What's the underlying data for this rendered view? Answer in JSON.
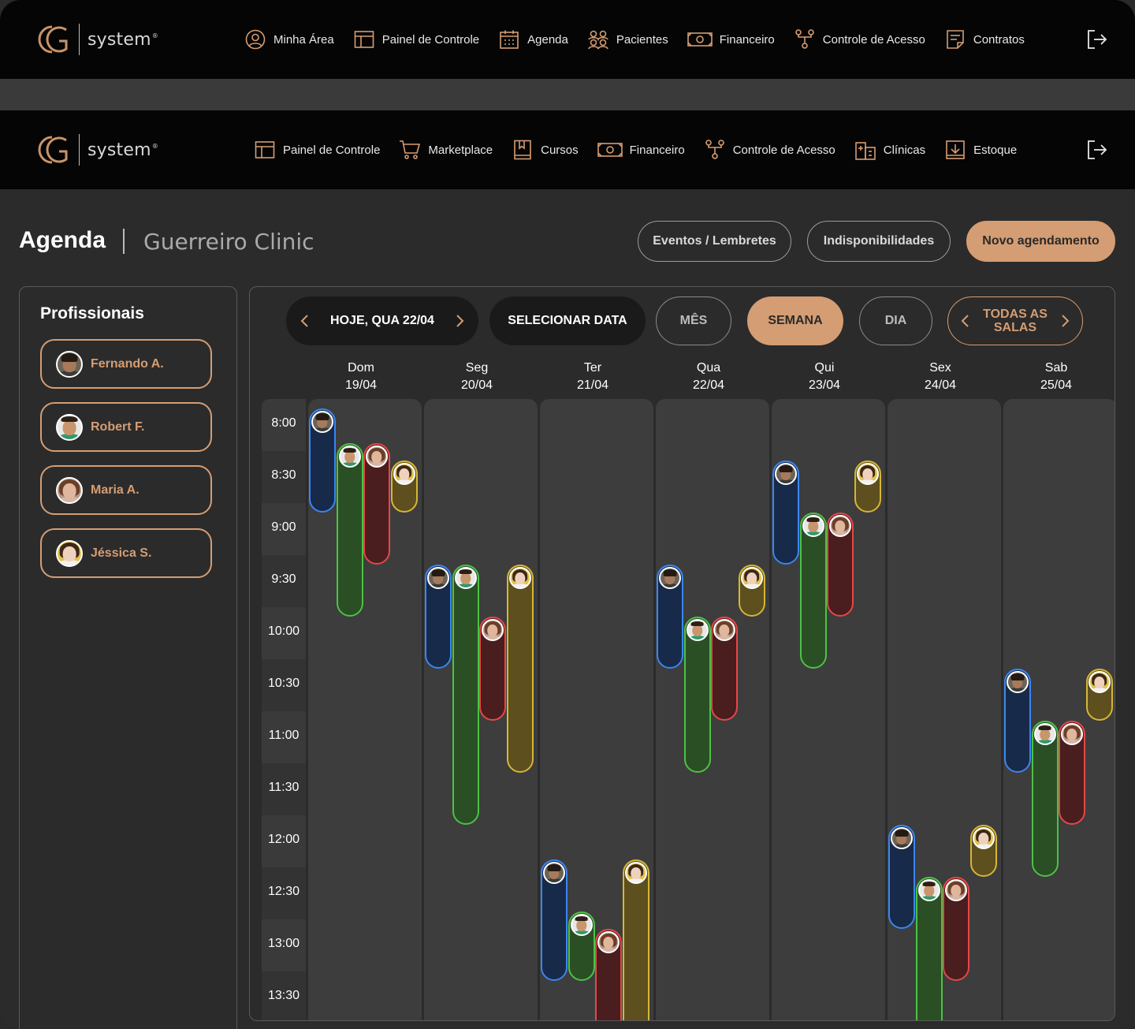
{
  "brand": {
    "name": "system",
    "mark": "®"
  },
  "nav_top": {
    "items": [
      {
        "label": "Minha Área",
        "icon": "user-circle-icon"
      },
      {
        "label": "Painel de Controle",
        "icon": "dashboard-icon"
      },
      {
        "label": "Agenda",
        "icon": "calendar-icon"
      },
      {
        "label": "Pacientes",
        "icon": "users-icon"
      },
      {
        "label": "Financeiro",
        "icon": "money-icon"
      },
      {
        "label": "Controle de Acesso",
        "icon": "access-icon"
      },
      {
        "label": "Contratos",
        "icon": "contract-icon"
      }
    ]
  },
  "nav_second": {
    "items": [
      {
        "label": "Painel de Controle",
        "icon": "dashboard-icon"
      },
      {
        "label": "Marketplace",
        "icon": "cart-icon"
      },
      {
        "label": "Cursos",
        "icon": "book-icon"
      },
      {
        "label": "Financeiro",
        "icon": "money-icon"
      },
      {
        "label": "Controle de Acesso",
        "icon": "access-icon"
      },
      {
        "label": "Clínicas",
        "icon": "building-icon"
      },
      {
        "label": "Estoque",
        "icon": "inbox-icon"
      }
    ]
  },
  "header": {
    "title": "Agenda",
    "clinic": "Guerreiro Clinic",
    "btn_events": "Eventos / Lembretes",
    "btn_unavailable": "Indisponibilidades",
    "btn_new": "Novo agendamento"
  },
  "professionals": {
    "title": "Profissionais",
    "items": [
      {
        "name": "Fernando A.",
        "avatar": "fernando"
      },
      {
        "name": "Robert F.",
        "avatar": "robert"
      },
      {
        "name": "Maria A.",
        "avatar": "maria"
      },
      {
        "name": "Jéssica S.",
        "avatar": "jessica"
      }
    ]
  },
  "calendar": {
    "today_label": "HOJE, QUA 22/04",
    "select_date": "SELECIONAR DATA",
    "view_month": "MÊS",
    "view_week": "SEMANA",
    "view_day": "DIA",
    "rooms_line1": "TODAS AS",
    "rooms_line2": "SALAS",
    "selected_view": "SEMANA",
    "days": [
      {
        "name": "Dom",
        "date": "19/04"
      },
      {
        "name": "Seg",
        "date": "20/04"
      },
      {
        "name": "Ter",
        "date": "21/04"
      },
      {
        "name": "Qua",
        "date": "22/04"
      },
      {
        "name": "Qui",
        "date": "23/04"
      },
      {
        "name": "Sex",
        "date": "24/04"
      },
      {
        "name": "Sab",
        "date": "25/04"
      }
    ],
    "times": [
      "8:00",
      "8:30",
      "9:00",
      "9:30",
      "10:00",
      "10:30",
      "11:00",
      "11:30",
      "12:00",
      "12:30",
      "13:00",
      "13:30"
    ],
    "colors": {
      "fernando": "#3b86f0",
      "robert": "#4cc245",
      "maria": "#e54848",
      "jessica": "#d6b637"
    },
    "appointments": [
      {
        "day": 0,
        "prof": "fernando",
        "start": "8:00",
        "end": "9:00"
      },
      {
        "day": 0,
        "prof": "robert",
        "start": "8:20",
        "end": "10:00"
      },
      {
        "day": 0,
        "prof": "maria",
        "start": "8:20",
        "end": "9:30"
      },
      {
        "day": 0,
        "prof": "jessica",
        "start": "8:30",
        "end": "9:00"
      },
      {
        "day": 1,
        "prof": "fernando",
        "start": "9:30",
        "end": "10:30"
      },
      {
        "day": 1,
        "prof": "robert",
        "start": "9:30",
        "end": "12:00"
      },
      {
        "day": 1,
        "prof": "maria",
        "start": "10:00",
        "end": "11:00"
      },
      {
        "day": 1,
        "prof": "jessica",
        "start": "9:30",
        "end": "11:30"
      },
      {
        "day": 2,
        "prof": "fernando",
        "start": "12:20",
        "end": "13:30"
      },
      {
        "day": 2,
        "prof": "robert",
        "start": "12:50",
        "end": "13:30"
      },
      {
        "day": 2,
        "prof": "maria",
        "start": "13:00",
        "end": "14:00"
      },
      {
        "day": 2,
        "prof": "jessica",
        "start": "12:20",
        "end": "14:00"
      },
      {
        "day": 3,
        "prof": "fernando",
        "start": "9:30",
        "end": "10:30"
      },
      {
        "day": 3,
        "prof": "robert",
        "start": "10:00",
        "end": "11:30"
      },
      {
        "day": 3,
        "prof": "maria",
        "start": "10:00",
        "end": "11:00"
      },
      {
        "day": 3,
        "prof": "jessica",
        "start": "9:30",
        "end": "10:00"
      },
      {
        "day": 4,
        "prof": "fernando",
        "start": "8:30",
        "end": "9:30"
      },
      {
        "day": 4,
        "prof": "robert",
        "start": "9:00",
        "end": "10:30"
      },
      {
        "day": 4,
        "prof": "maria",
        "start": "9:00",
        "end": "10:00"
      },
      {
        "day": 4,
        "prof": "jessica",
        "start": "8:30",
        "end": "9:00"
      },
      {
        "day": 5,
        "prof": "fernando",
        "start": "12:00",
        "end": "13:00"
      },
      {
        "day": 5,
        "prof": "robert",
        "start": "12:30",
        "end": "14:00"
      },
      {
        "day": 5,
        "prof": "maria",
        "start": "12:30",
        "end": "13:30"
      },
      {
        "day": 5,
        "prof": "jessica",
        "start": "12:00",
        "end": "12:30"
      },
      {
        "day": 6,
        "prof": "fernando",
        "start": "10:30",
        "end": "11:30"
      },
      {
        "day": 6,
        "prof": "robert",
        "start": "11:00",
        "end": "12:30"
      },
      {
        "day": 6,
        "prof": "maria",
        "start": "11:00",
        "end": "12:00"
      },
      {
        "day": 6,
        "prof": "jessica",
        "start": "10:30",
        "end": "11:00"
      }
    ]
  }
}
